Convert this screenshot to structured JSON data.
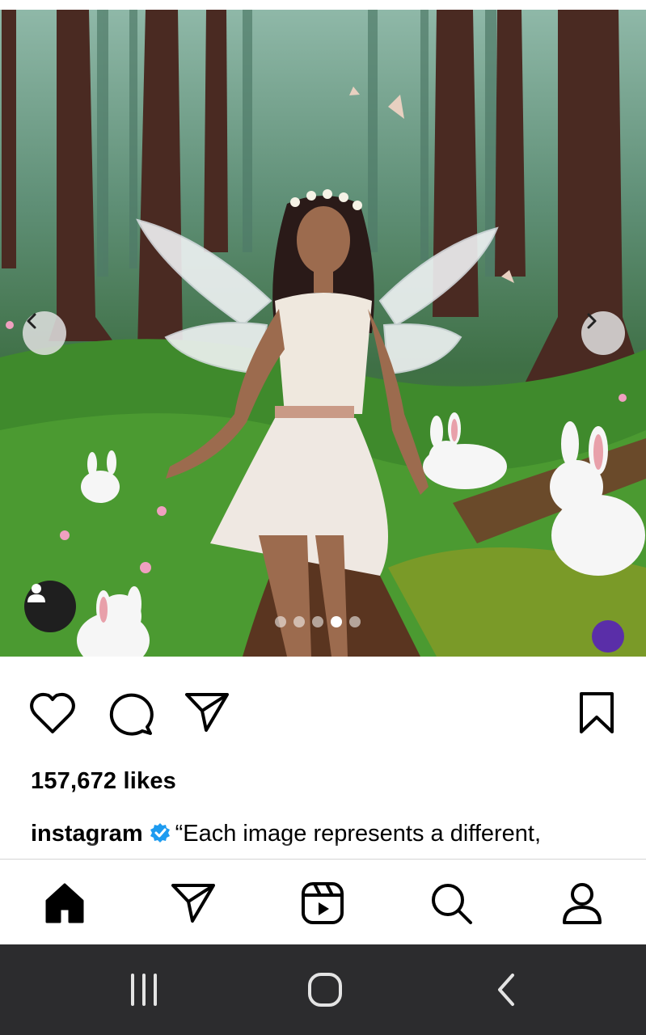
{
  "post": {
    "carousel": {
      "total": 5,
      "active_index": 3
    },
    "likes": "157,672 likes",
    "caption": {
      "username": "instagram",
      "text": "“Each image represents a different,"
    }
  },
  "icons": {
    "prev": "chevron-left-icon",
    "next": "chevron-right-icon",
    "like": "heart-icon",
    "comment": "comment-icon",
    "share": "send-icon",
    "save": "bookmark-icon",
    "tag": "user-tag-icon",
    "verified": "verified-badge-icon"
  },
  "tab_bar": [
    {
      "name": "home-tab",
      "icon": "home-icon",
      "active": true
    },
    {
      "name": "messages-tab",
      "icon": "send-icon",
      "active": false
    },
    {
      "name": "reels-tab",
      "icon": "reels-icon",
      "active": false
    },
    {
      "name": "search-tab",
      "icon": "search-icon",
      "active": false
    },
    {
      "name": "profile-tab",
      "icon": "profile-icon",
      "active": false
    }
  ],
  "colors": {
    "verified": "#1d9bf0",
    "text": "#000000",
    "system_nav": "#2c2c2e"
  }
}
